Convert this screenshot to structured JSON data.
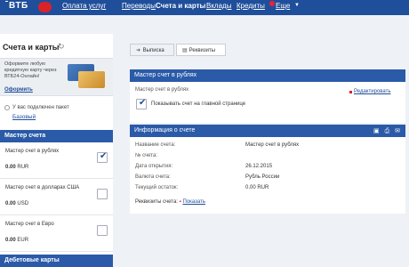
{
  "nav": {
    "logo": "ВТБ",
    "items": [
      "Оплата услуг",
      "Переводы",
      "Счета и карты",
      "Вклады",
      "Кредиты",
      "Еще"
    ]
  },
  "sidebar": {
    "title": "Счета и карты",
    "promo_text": "Оформите любую кредитную карту через ВТБ24-Онлайн!",
    "promo_link": "Оформить",
    "package_label": "У вас подключен пакет",
    "package_link": "Базовый",
    "section_master": "Мастер счета",
    "accounts": [
      {
        "name": "Мастер счет в рублях",
        "amount": "0.00",
        "currency": "RUR",
        "checked": true
      },
      {
        "name": "Мастер счет в долларах США",
        "amount": "0.00",
        "currency": "USD",
        "checked": false
      },
      {
        "name": "Мастер счет в Евро",
        "amount": "0.00",
        "currency": "EUR",
        "checked": false
      }
    ],
    "section_debit": "Дебетовые карты"
  },
  "tabs": {
    "statement": "Выписка",
    "details": "Реквизиты"
  },
  "account_panel": {
    "title": "Мастер счет в рублях",
    "account_label": "Мастер счет в рублях",
    "edit_link": "Редактировать",
    "show_on_main": "Показывать счет на главной странице"
  },
  "info_panel": {
    "title": "Информация о счете",
    "rows": [
      {
        "label": "Название счета:",
        "value": "Мастер счет в рублях"
      },
      {
        "label": "№ счета:",
        "value": ""
      },
      {
        "label": "Дата открытия:",
        "value": "26.12.2015"
      },
      {
        "label": "Валюта счета:",
        "value": "Рубль России"
      },
      {
        "label": "Текущий остаток:",
        "value": "0.00 RUR"
      }
    ],
    "requisites_label": "Реквизиты счета:",
    "requisites_link": "Показать"
  },
  "colors": {
    "brand_blue": "#1f4e9b",
    "header_blue": "#2a5aa8",
    "accent_red": "#d8232a"
  }
}
